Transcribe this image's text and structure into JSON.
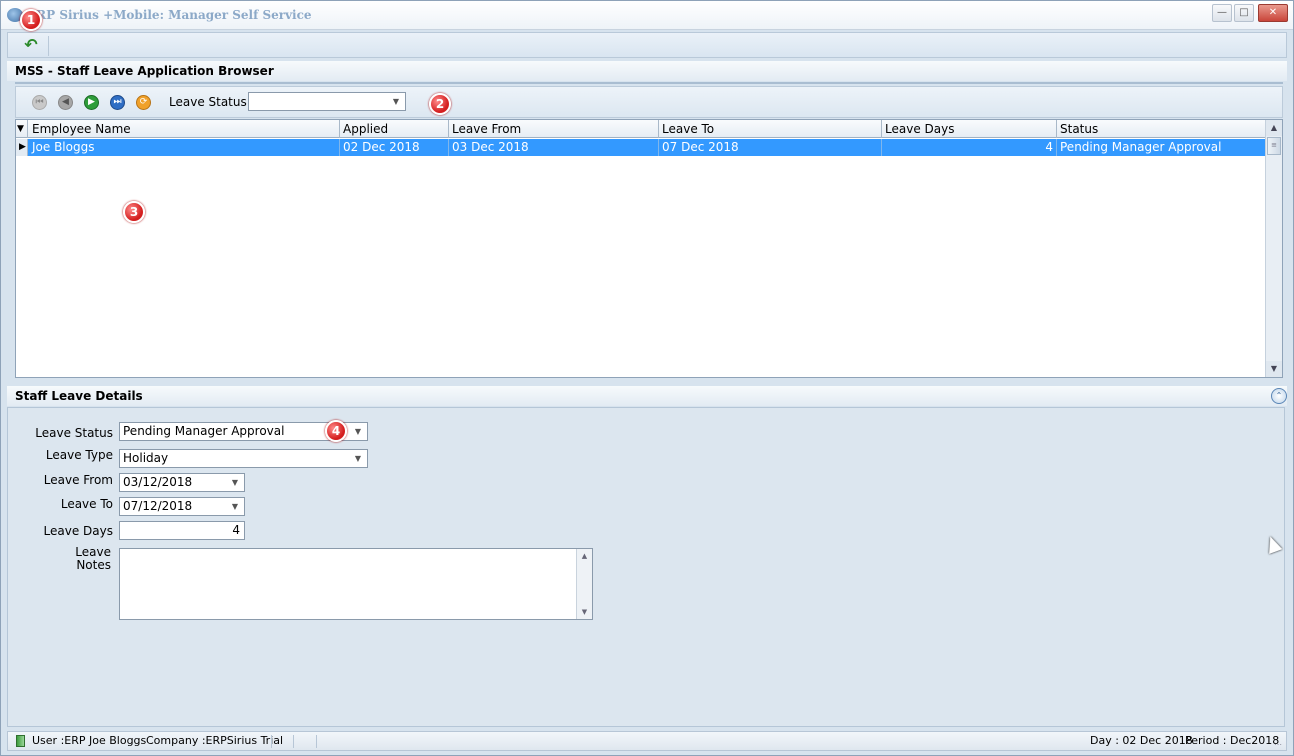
{
  "window": {
    "title": "ERP Sirius +Mobile: Manager Self Service",
    "minimize_icon": "minimize-icon",
    "maximize_icon": "maximize-icon",
    "close_icon": "close-icon"
  },
  "toolbar": {
    "back_icon": "back-arrow-icon"
  },
  "browser": {
    "title": "MSS - Staff Leave Application Browser",
    "nav_icons": [
      "first-record-icon",
      "previous-record-icon",
      "next-record-icon",
      "last-record-icon",
      "refresh-icon"
    ],
    "filter": {
      "label": "Leave Status",
      "value": ""
    },
    "grid": {
      "columns": [
        "Employee Name",
        "Applied",
        "Leave From",
        "Leave To",
        "Leave Days",
        "Status"
      ],
      "rows": [
        {
          "employee_name": "Joe Bloggs",
          "applied": "02 Dec 2018",
          "leave_from": "03 Dec 2018",
          "leave_to": "07 Dec 2018",
          "leave_days": "4",
          "status": "Pending Manager Approval"
        }
      ]
    }
  },
  "details": {
    "title": "Staff Leave Details",
    "fields": {
      "leave_status": {
        "label": "Leave Status",
        "value": "Pending Manager Approval"
      },
      "leave_type": {
        "label": "Leave Type",
        "value": "Holiday"
      },
      "leave_from": {
        "label": "Leave From",
        "value": "03/12/2018"
      },
      "leave_to": {
        "label": "Leave To",
        "value": "07/12/2018"
      },
      "leave_days": {
        "label": "Leave Days",
        "value": "4"
      },
      "leave_notes": {
        "label_line1": "Leave",
        "label_line2": "Notes",
        "value": ""
      }
    }
  },
  "markers": [
    "1",
    "2",
    "3",
    "4"
  ],
  "statusbar": {
    "user": "User :ERP Joe Bloggs",
    "company": "Company :ERPSirius Trial",
    "day": "Day : 02 Dec 2018",
    "period": "Period : Dec2018"
  },
  "colors": {
    "selection": "#3399ff",
    "marker": "#d41e1e"
  }
}
